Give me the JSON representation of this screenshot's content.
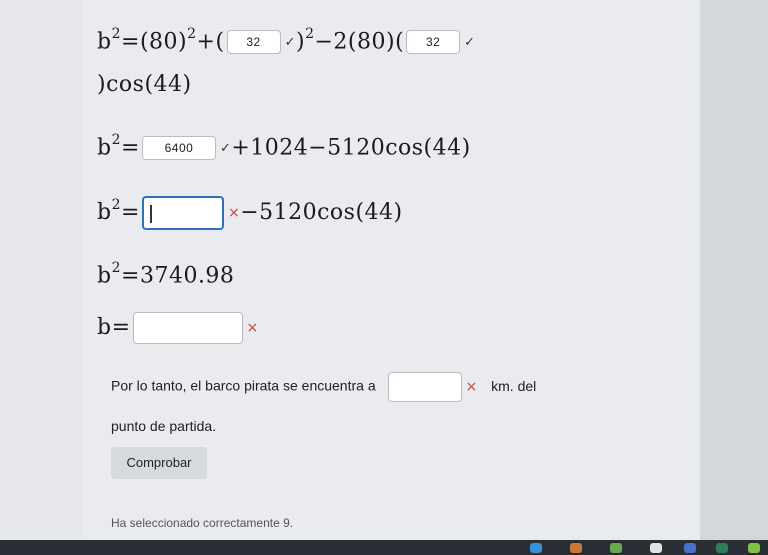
{
  "equations": {
    "line1": {
      "lhs": "b",
      "lhs_exp": "2",
      "part1": "=(80)",
      "exp1": "2",
      "part2": "+(",
      "box1": "32",
      "part3": ")",
      "exp2": "2",
      "part4": "−2(80)(",
      "box2": "32",
      "cont": ")cos(44)"
    },
    "line2": {
      "lhs": "b",
      "lhs_exp": "2",
      "eq": "=",
      "box": "6400",
      "rest": "+1024−5120cos(44)"
    },
    "line3": {
      "lhs": "b",
      "lhs_exp": "2",
      "eq": "=",
      "box": "",
      "rest": "−5120cos(44)"
    },
    "line4": {
      "lhs": "b",
      "lhs_exp": "2",
      "rest": "=3740.98"
    },
    "line5": {
      "lhs": "b",
      "eq": "=",
      "box": ""
    }
  },
  "sentence": {
    "before": "Por lo tanto, el barco pirata se encuentra a",
    "box": "",
    "unit": "km. del",
    "line2": "punto de partida."
  },
  "button": {
    "label": "Comprobar"
  },
  "feedback": {
    "text": "Ha seleccionado correctamente 9."
  },
  "icons": {
    "check": "✓",
    "cross": "×"
  },
  "colors": {
    "accent": "#2f6fbf",
    "error": "#d23c3c"
  }
}
